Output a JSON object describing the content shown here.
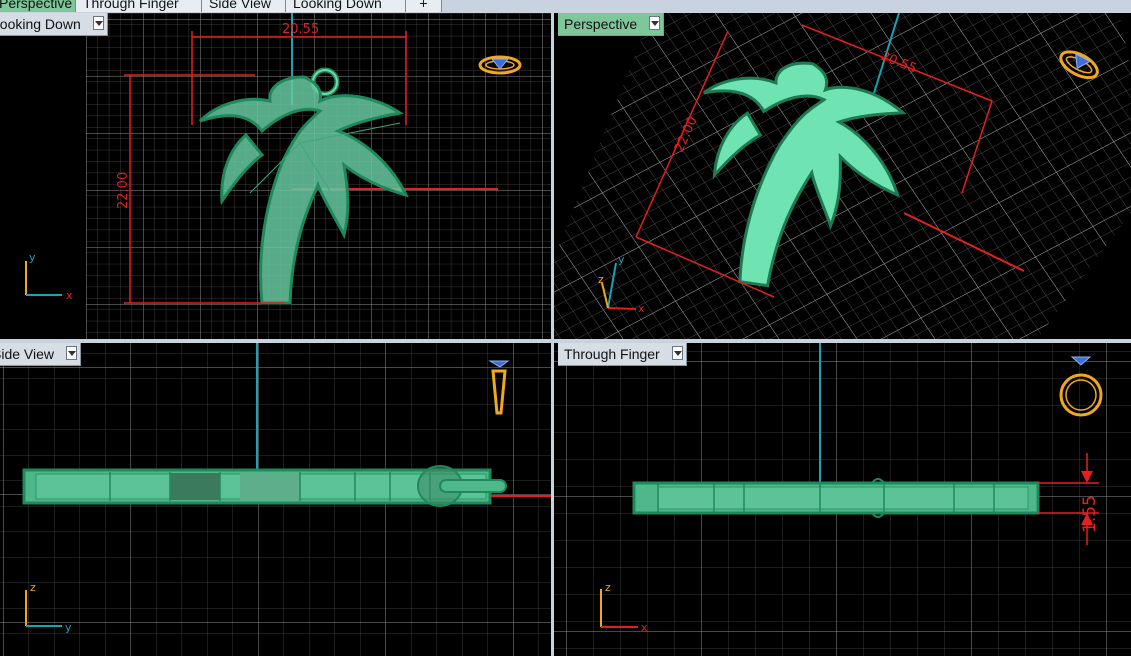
{
  "tabs": [
    {
      "label": "Perspective",
      "active": true
    },
    {
      "label": "Through Finger",
      "active": false
    },
    {
      "label": "Side View",
      "active": false
    },
    {
      "label": "Looking Down",
      "active": false
    }
  ],
  "add_tab_symbol": "+",
  "viewports": {
    "top_left": {
      "label": "Looking Down",
      "dim_width": "20.55",
      "dim_height": "22.00",
      "axis_v": "y",
      "axis_h": "x"
    },
    "top_right": {
      "label": "Perspective",
      "dim_width": "20.55",
      "dim_height": "22.00",
      "axis_v": "y",
      "axis_z": "z",
      "axis_h": "x"
    },
    "bottom_left": {
      "label": "Side View",
      "axis_v": "z",
      "axis_h": "y"
    },
    "bottom_right": {
      "label": "Through Finger",
      "dim_thickness": "1.55",
      "axis_v": "z",
      "axis_h": "x"
    }
  },
  "colors": {
    "model_fill": "#5fcf9f",
    "model_edge": "#1e8a5c",
    "dimension": "#e51f1f",
    "axis_y": "#18a3b8",
    "grid": "#8a8a8a",
    "ring_icon": "#f0a820",
    "gem_icon": "#3f6fd6",
    "active_tab": "#7fc79a"
  },
  "icons": [
    "ring-top-icon",
    "ring-perspective-icon",
    "ring-side-icon",
    "ring-front-icon"
  ]
}
